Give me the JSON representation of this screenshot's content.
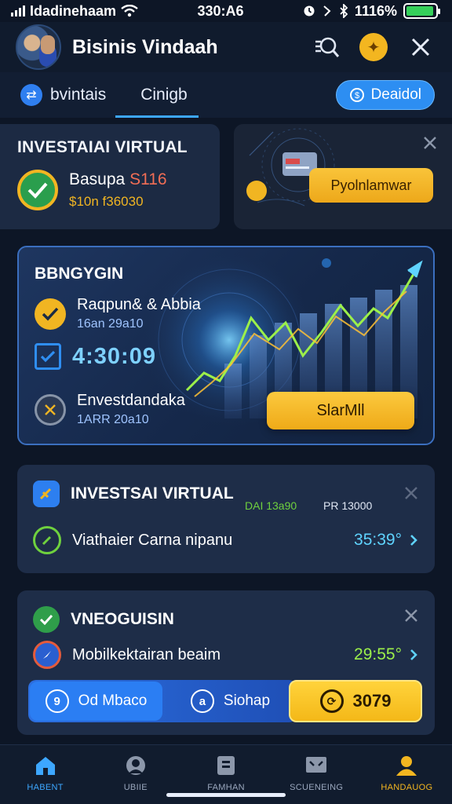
{
  "status_bar": {
    "carrier": "Idadinehaam",
    "time": "330:A6",
    "battery_text": "1116%",
    "battery_level": 0.95
  },
  "header": {
    "title": "Bisinis Vindaah"
  },
  "tabs": [
    {
      "label": "bvintais"
    },
    {
      "label": "Cinigb"
    }
  ],
  "deposit": {
    "label": "Deaidol"
  },
  "card_invest": {
    "title": "INVESTAIAI VIRTUAL",
    "balance_label": "Basupa",
    "balance_value": "S116",
    "sub": "$10n f36030"
  },
  "card_promo": {
    "button": "Pyolnlamwar"
  },
  "hero": {
    "title": "BBNGYGIN",
    "row1_main": "Raqpun& & Abbia",
    "row1_sub": "16an 29a10",
    "timer": "4:30:09",
    "row3_main": "Envestdandaka",
    "row3_sub": "1ARR 20a10",
    "start_button": "SlarMll"
  },
  "card_list1": {
    "title": "INVESTSAI VIRTUAL",
    "meta_green": "DAI 13a90",
    "meta_white": "PR 13000",
    "row_text": "Viathaier Carna nipanu",
    "row_value": "35:39°"
  },
  "card_list2": {
    "title": "VNEOGUISIN",
    "row_text": "Mobilkektairan beaim",
    "row_value": "29:55°",
    "seg_left": "Od Mbaco",
    "seg_left_icon": "9",
    "seg_right": "Siohap",
    "seg_right_icon": "a",
    "score": "3079"
  },
  "bottom_nav": [
    {
      "label": "HABENT"
    },
    {
      "label": "UBIIE"
    },
    {
      "label": "FAMHAN"
    },
    {
      "label": "SCUENEING"
    },
    {
      "label": "HANDAUOG"
    }
  ],
  "colors": {
    "background": "#0d1626",
    "card": "#1c2a43",
    "accent_blue": "#2d8ef2",
    "accent_yellow": "#f3b620",
    "positive_green": "#6fd13e",
    "chart_cyan": "#5fd3ff"
  }
}
